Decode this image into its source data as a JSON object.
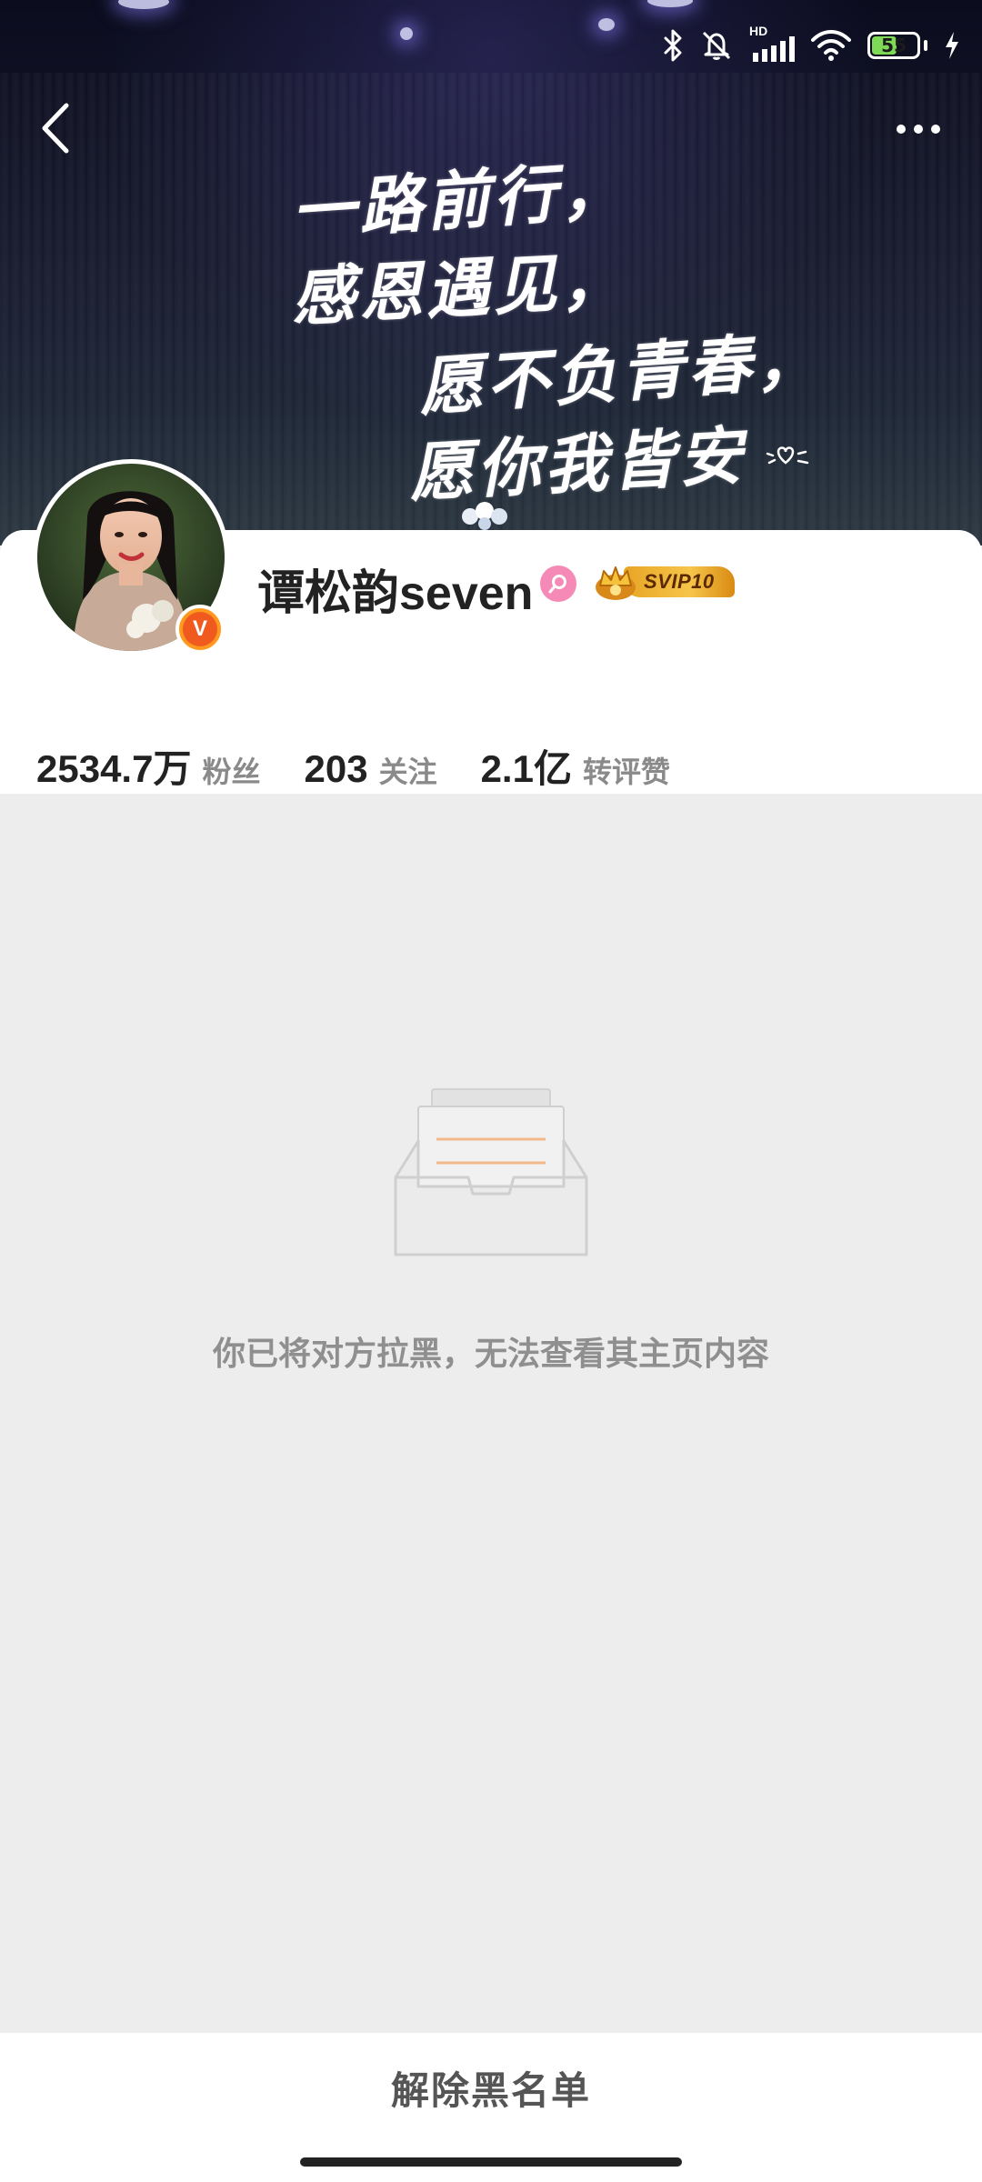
{
  "status_bar": {
    "network_label": "HD",
    "battery_level": "55",
    "battery_percent": 55
  },
  "cover": {
    "lines": [
      "一路前行，",
      "感恩遇见，",
      "愿不负青春，",
      "愿你我皆安"
    ]
  },
  "profile": {
    "username": "谭松韵seven",
    "verified_badge": "V",
    "vip_label": "SVIP10",
    "gender_icon": "female-icon"
  },
  "stats": [
    {
      "value": "2534.7万",
      "label": "粉丝"
    },
    {
      "value": "203",
      "label": "关注"
    },
    {
      "value": "2.1亿",
      "label": "转评赞"
    }
  ],
  "empty_state": {
    "icon": "empty-inbox-icon",
    "message": "你已将对方拉黑，无法查看其主页内容"
  },
  "actions": {
    "unblock_label": "解除黑名单"
  },
  "colors": {
    "accent_orange": "#f05a1f",
    "gender_pink": "#f58ab6",
    "battery_green": "#7ed957",
    "vip_gold": "#f6c54a",
    "background": "#ededed"
  }
}
